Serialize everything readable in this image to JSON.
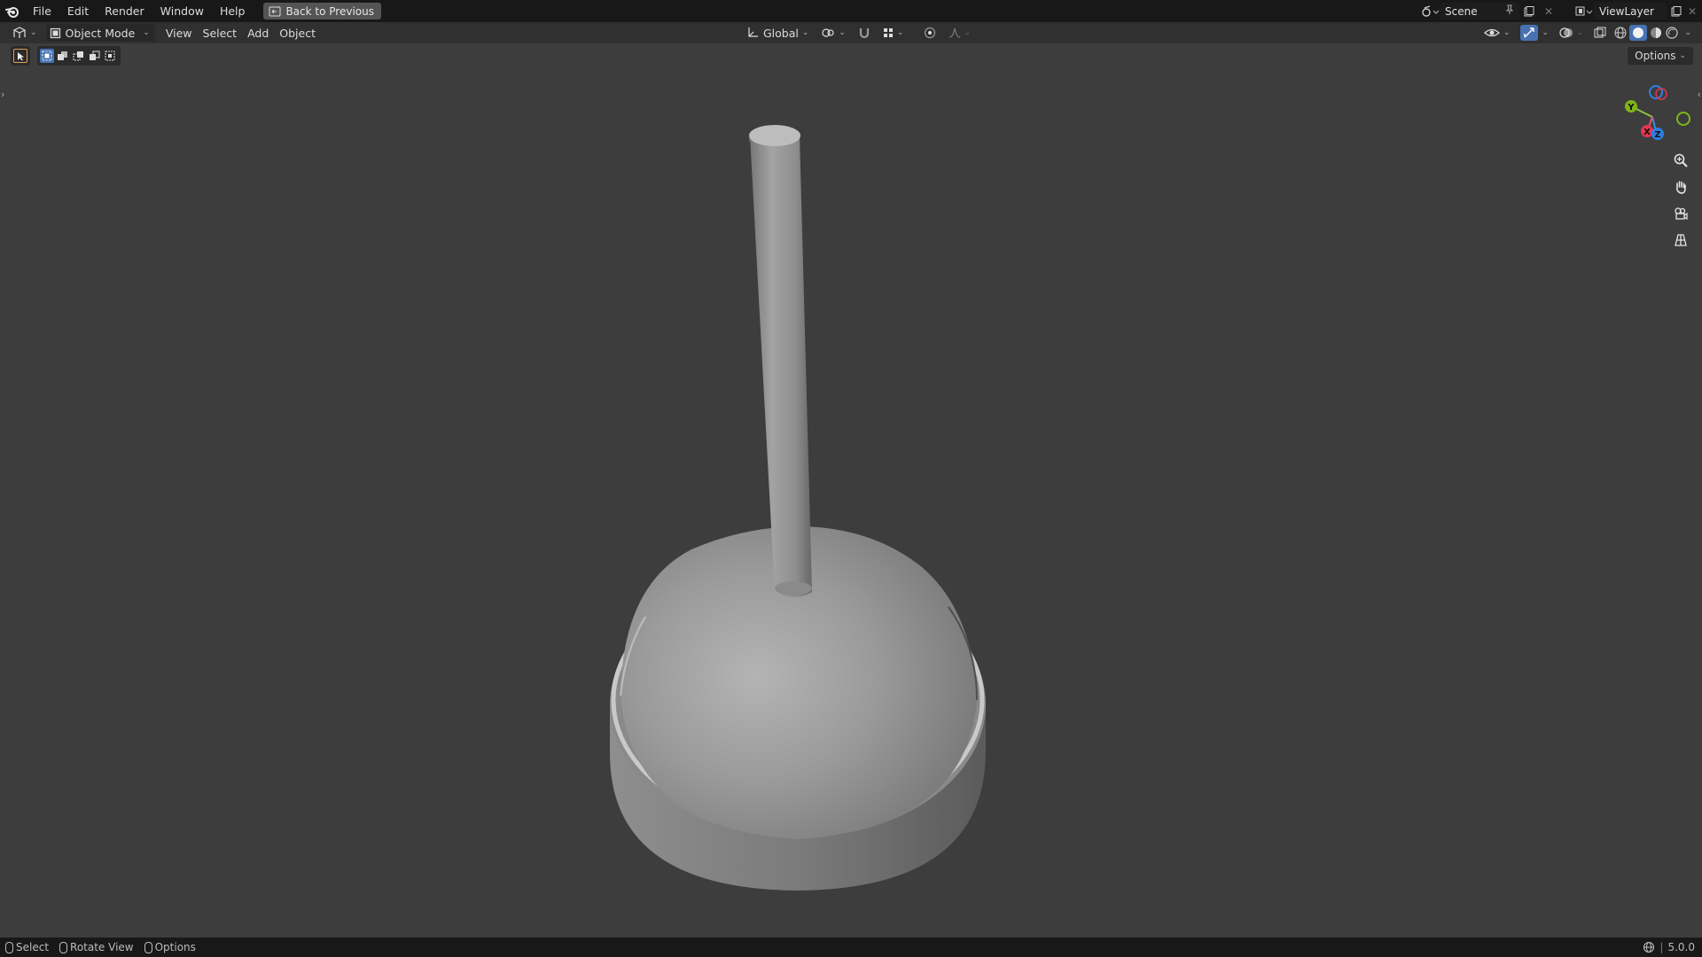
{
  "topbar": {
    "logo_icon": "blender-logo-icon",
    "menus": [
      "File",
      "Edit",
      "Render",
      "Window",
      "Help"
    ],
    "back_button": "Back to Previous",
    "scene_name": "Scene",
    "view_layer": "ViewLayer"
  },
  "header": {
    "mode": "Object Mode",
    "menus": [
      "View",
      "Select",
      "Add",
      "Object"
    ],
    "transform_orientation": "Global"
  },
  "toolbar": {
    "options_label": "Options"
  },
  "gizmo": {
    "axes": {
      "x": "X",
      "y": "Y",
      "z": "Z"
    },
    "colors": {
      "x": "#e3364f",
      "y": "#7fb51a",
      "z": "#2f7fe0"
    }
  },
  "statusbar": {
    "select": "Select",
    "rotate": "Rotate View",
    "options": "Options",
    "version": "5.0.0"
  },
  "colors": {
    "viewport_bg": "#3d3d3d",
    "topbar_bg": "#181818",
    "header_bg": "#303030",
    "accent": "#4772b3"
  }
}
